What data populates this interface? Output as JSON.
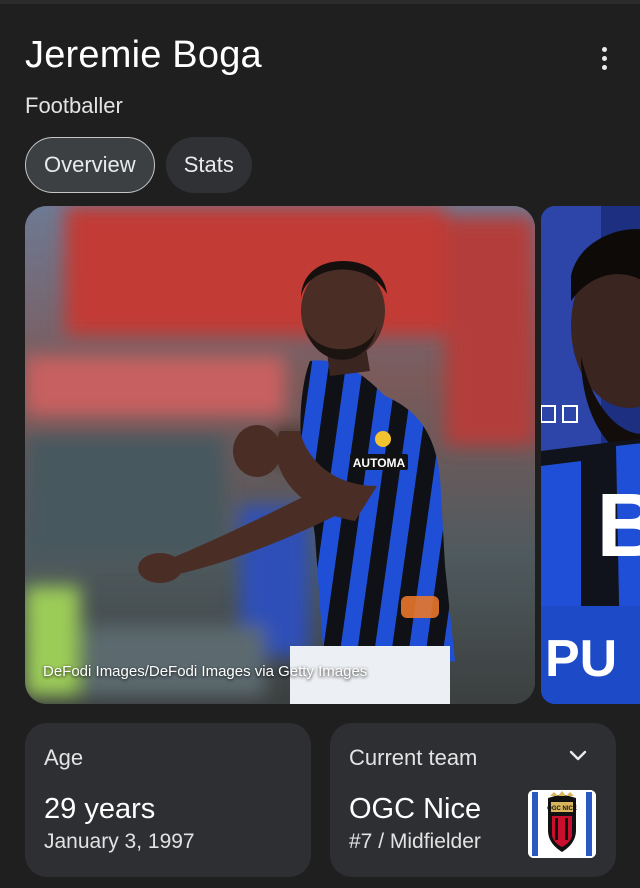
{
  "header": {
    "title": "Jeremie Boga",
    "subtitle": "Footballer",
    "more_icon": "more-vert-icon"
  },
  "tabs": [
    {
      "label": "Overview",
      "active": true
    },
    {
      "label": "Stats",
      "active": false
    }
  ],
  "gallery": {
    "main_credit": "DeFodi Images/DeFodi Images via Getty Images",
    "second_image_text": "B"
  },
  "facts": {
    "age": {
      "label": "Age",
      "value": "29 years",
      "detail": "January 3, 1997"
    },
    "team": {
      "label": "Current team",
      "value": "OGC Nice",
      "detail": "#7 / Midfielder",
      "expand_icon": "chevron-down-icon",
      "crest_text": "OGC NICE"
    }
  },
  "colors": {
    "background": "#1f1f1f",
    "card": "#2e2f33",
    "chip_active_border": "#c4c7c5",
    "kit_blue": "#1f4fd6",
    "kit_black": "#0f1116"
  }
}
